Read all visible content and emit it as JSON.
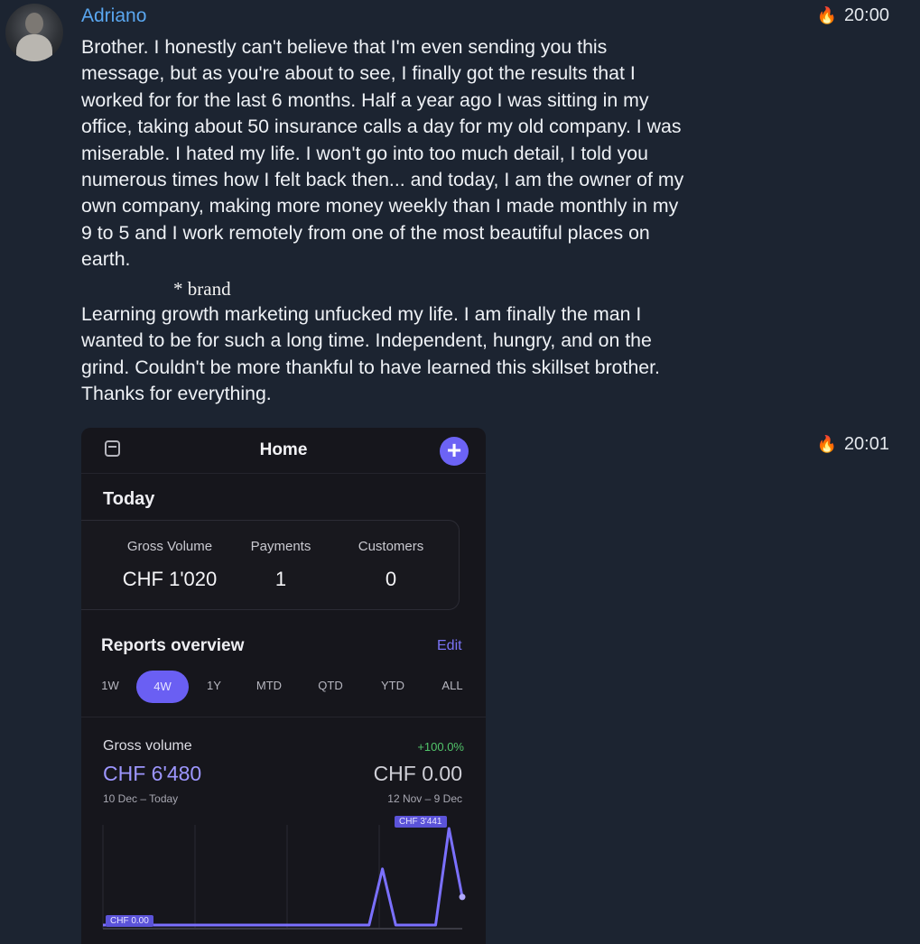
{
  "message1": {
    "sender": "Adriano",
    "time": "20:00",
    "reaction_icon": "fire-icon",
    "text": "Brother. I honestly can't believe that I'm even sending you this\nmessage, but as you're about to see, I finally got the results that I\nworked for for the last 6 months. Half a year ago I was sitting in my\noffice, taking about 50 insurance calls a day for my old company. I was\nmiserable. I hated my life. I won't go into too much detail, I told you\nnumerous times how I felt back then... and today, I am the owner of my\nown company, making more money weekly than I made monthly in my\n9 to 5 and I work remotely from one of the most beautiful places on\nearth.",
    "annotation": "* brand",
    "text2": "Learning growth marketing unfucked my life. I am finally the man I\nwanted to be for such a long time. Independent, hungry, and on the\ngrind. Couldn't be more thankful to have learned this skillset brother.\nThanks for everything."
  },
  "message2": {
    "time": "20:01",
    "reaction_icon": "fire-icon"
  },
  "screenshot": {
    "title": "Home",
    "today_label": "Today",
    "stats": [
      {
        "label": "Gross Volume",
        "value": "CHF 1'020"
      },
      {
        "label": "Payments",
        "value": "1"
      },
      {
        "label": "Customers",
        "value": "0"
      }
    ],
    "reports_title": "Reports overview",
    "edit_label": "Edit",
    "periods": [
      "1W",
      "4W",
      "1Y",
      "MTD",
      "QTD",
      "YTD",
      "ALL"
    ],
    "active_period": "4W",
    "gross_volume": {
      "label": "Gross volume",
      "change": "+100.0%",
      "value": "CHF 6'480",
      "previous_value": "CHF 0.00",
      "range": "10 Dec – Today",
      "previous_range": "12 Nov – 9 Dec"
    },
    "colors": {
      "accent": "#6c63f5",
      "positive": "#52c46a",
      "background": "#16161c"
    }
  },
  "chart_data": {
    "type": "line",
    "title": "",
    "xlabel": "",
    "ylabel": "",
    "x": [
      1,
      2,
      3,
      4,
      5,
      6,
      7,
      8,
      9,
      10,
      11,
      12,
      13,
      14,
      15,
      16,
      17,
      18,
      19,
      20,
      21,
      22,
      23,
      24,
      25,
      26,
      27,
      28
    ],
    "series": [
      {
        "values": [
          0,
          0,
          0,
          0,
          0,
          0,
          0,
          0,
          0,
          0,
          0,
          0,
          0,
          0,
          0,
          0,
          0,
          0,
          0,
          0,
          0,
          2000,
          0,
          0,
          0,
          0,
          3441,
          1000
        ]
      }
    ],
    "ylim": [
      0,
      3441
    ],
    "annotations": [
      "CHF 3'441",
      "CHF 0.00"
    ]
  }
}
